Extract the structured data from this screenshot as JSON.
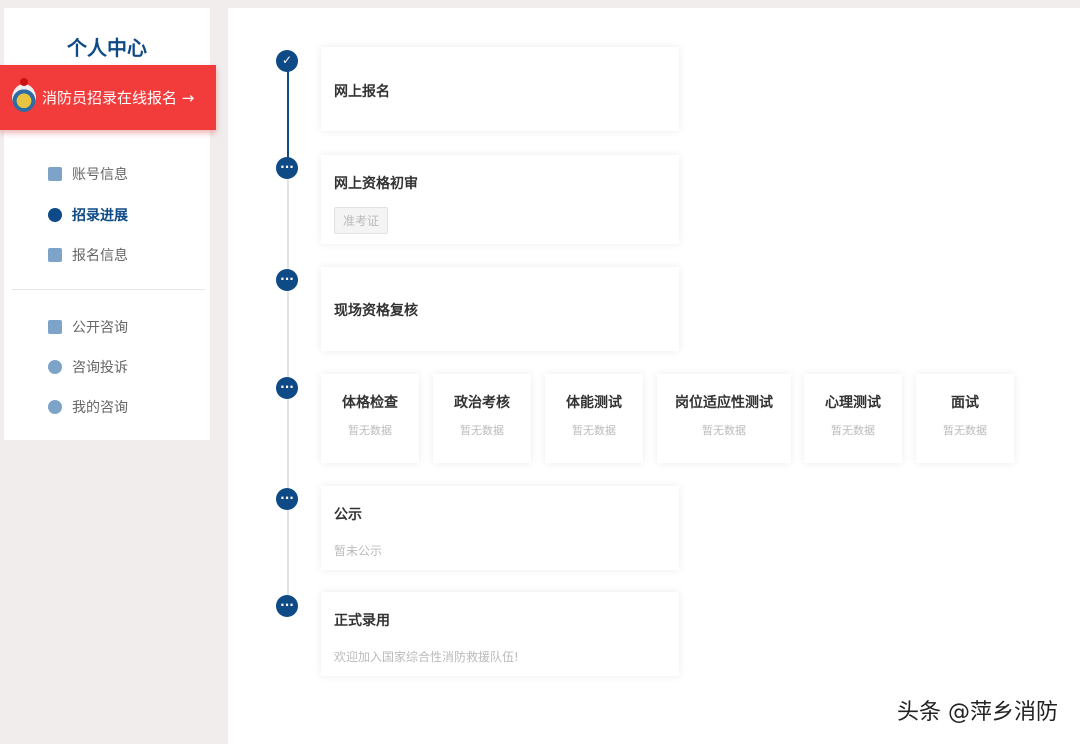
{
  "sidebar": {
    "title": "个人中心",
    "banner": "消防员招录在线报名 →",
    "items": [
      {
        "label": "账号信息",
        "icon": "id-card-icon"
      },
      {
        "label": "招录进展",
        "icon": "list-icon",
        "active": true
      },
      {
        "label": "报名信息",
        "icon": "edit-icon"
      },
      {
        "label": "公开咨询",
        "icon": "document-icon"
      },
      {
        "label": "咨询投诉",
        "icon": "chat-icon"
      },
      {
        "label": "我的咨询",
        "icon": "consult-icon"
      }
    ]
  },
  "timeline": {
    "steps": [
      {
        "title": "网上报名",
        "status": "done"
      },
      {
        "title": "网上资格初审",
        "button": "准考证"
      },
      {
        "title": "现场资格复核"
      },
      {
        "title": "公示",
        "note": "暂未公示"
      },
      {
        "title": "正式录用",
        "note": "欢迎加入国家综合性消防救援队伍!"
      }
    ],
    "checks": [
      {
        "title": "体格检查",
        "note": "暂无数据"
      },
      {
        "title": "政治考核",
        "note": "暂无数据"
      },
      {
        "title": "体能测试",
        "note": "暂无数据"
      },
      {
        "title": "岗位适应性测试",
        "note": "暂无数据"
      },
      {
        "title": "心理测试",
        "note": "暂无数据"
      },
      {
        "title": "面试",
        "note": "暂无数据"
      }
    ]
  },
  "watermark": "头条 @萍乡消防",
  "colors": {
    "primary": "#0e4a86",
    "banner": "#f23b3b"
  }
}
